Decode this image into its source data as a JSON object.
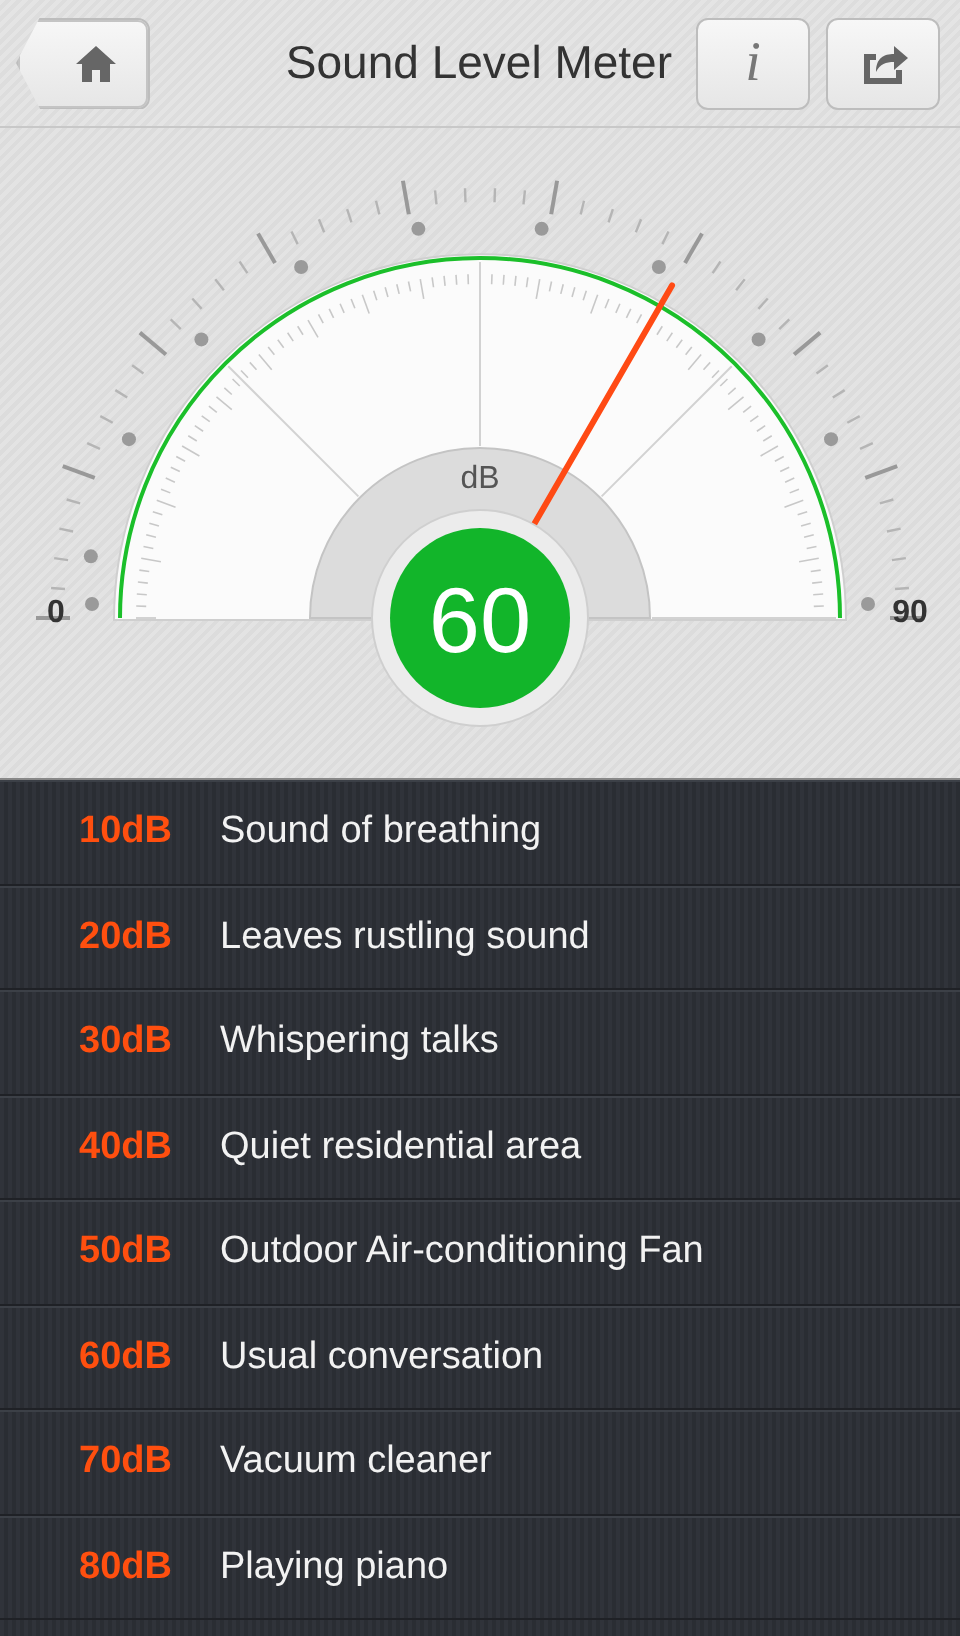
{
  "header": {
    "title": "Sound Level Meter",
    "info_button": "i"
  },
  "gauge": {
    "min_label": "0",
    "max_label": "90",
    "unit": "dB",
    "reading": "60"
  },
  "levels": [
    {
      "db": "10dB",
      "description": "Sound of breathing"
    },
    {
      "db": "20dB",
      "description": "Leaves rustling sound"
    },
    {
      "db": "30dB",
      "description": "Whispering talks"
    },
    {
      "db": "40dB",
      "description": "Quiet residential area"
    },
    {
      "db": "50dB",
      "description": "Outdoor Air-conditioning Fan"
    },
    {
      "db": "60dB",
      "description": "Usual conversation"
    },
    {
      "db": "70dB",
      "description": "Vacuum cleaner"
    },
    {
      "db": "80dB",
      "description": "Playing piano"
    }
  ]
}
